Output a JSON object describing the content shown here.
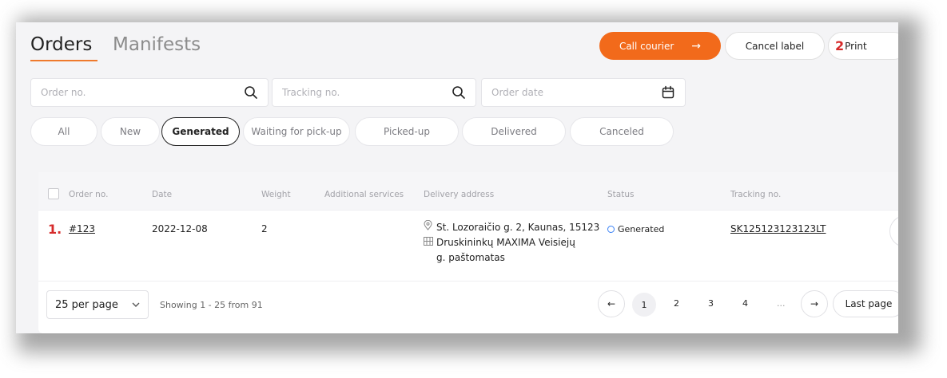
{
  "header": {
    "tabs": [
      {
        "label": "Orders",
        "active": true
      },
      {
        "label": "Manifests",
        "active": false
      }
    ],
    "buttons": {
      "call_courier": "Call courier",
      "call_courier_arrow": "→",
      "cancel_label": "Cancel label",
      "print_marker": "2",
      "print": "Print"
    }
  },
  "search": {
    "order_no_placeholder": "Order no.",
    "tracking_no_placeholder": "Tracking no.",
    "order_date_placeholder": "Order date"
  },
  "filters": [
    {
      "label": "All",
      "active": false
    },
    {
      "label": "New",
      "active": false
    },
    {
      "label": "Generated",
      "active": true
    },
    {
      "label": "Waiting for pick-up",
      "active": false
    },
    {
      "label": "Picked-up",
      "active": false
    },
    {
      "label": "Delivered",
      "active": false
    },
    {
      "label": "Canceled",
      "active": false
    }
  ],
  "table": {
    "columns": [
      "Order no.",
      "Date",
      "Weight",
      "Additional services",
      "Delivery address",
      "Status",
      "Tracking no."
    ],
    "rows": [
      {
        "marker": "1.",
        "order_no": "#123",
        "date": "2022-12-08",
        "weight": "2",
        "additional_services": "",
        "address_line_1": "St. Lozoraičio g. 2, Kaunas, 15123",
        "address_line_2": "Druskininkų MAXIMA Veisiejų",
        "address_line_3": "g. paštomatas",
        "status": "Generated",
        "tracking_no": "SK125123123123LT"
      }
    ]
  },
  "pagination": {
    "per_page": "25 per page",
    "showing": "Showing 1 - 25 from 91",
    "prev": "←",
    "pages": [
      "1",
      "2",
      "3",
      "4",
      "..."
    ],
    "current_page": "1",
    "next": "→",
    "last_page": "Last page"
  },
  "colors": {
    "accent": "#f26a1b",
    "marker_red": "#d62b2b",
    "status_blue": "#3b82f6"
  }
}
